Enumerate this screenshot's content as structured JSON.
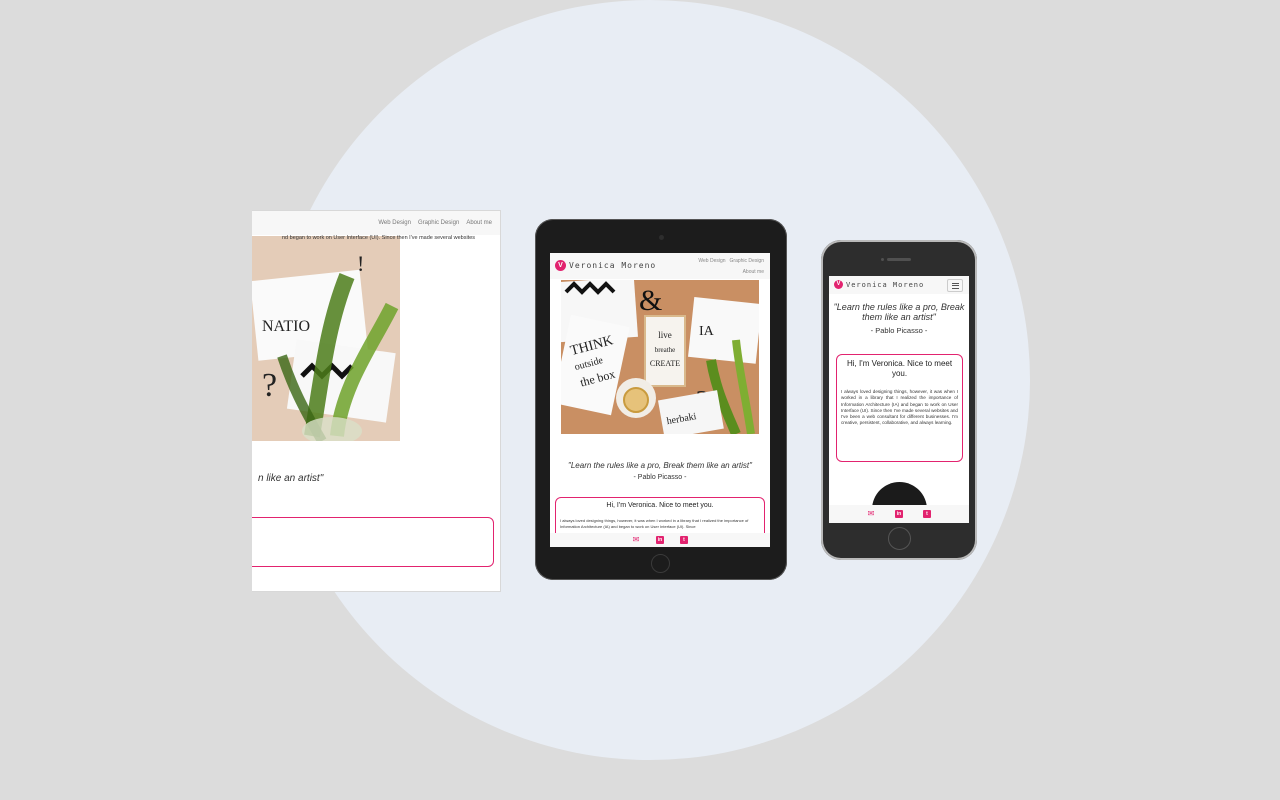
{
  "colors": {
    "accent": "#e2236f",
    "background": "#dcdcdc",
    "circle": "#e8edf4"
  },
  "desktop": {
    "nav": [
      "Web Design",
      "Graphic Design",
      "About me"
    ],
    "quote_partial": "n like an artist\"",
    "card_text_partial": "nd began to work on User Interface (UI). Since then I've made several websites"
  },
  "tablet": {
    "logo_letter": "V",
    "logo_text": "Veronica Moreno",
    "nav": [
      "Web Design",
      "Graphic Design",
      "About me"
    ],
    "quote": "\"Learn the rules like a pro, Break them like an artist\"",
    "author": "- Pablo Picasso -",
    "card_title": "Hi, I'm Veronica. Nice to meet you.",
    "card_body": "I always loved designing things, however, it was when I worked in a library that I realized the importance of Information Architecture (IA) and began to work on User Interface (UI). Since"
  },
  "phone": {
    "logo_letter": "V",
    "logo_text": "Veronica Moreno",
    "quote": "\"Learn the rules like a pro, Break them like an artist\"",
    "author": "- Pablo Picasso -",
    "card_title": "Hi, I'm Veronica. Nice to meet you.",
    "card_body": "I always loved designing things, however, it was when I worked in a library that I realized the importance of Information Architecture (IA) and began to work on User Interface (UI). Since then I've made several websites and I've been a web consultant for different businesses. I'm creative, persistent, collaborative, and always learning."
  },
  "icons": [
    "envelope-icon",
    "linkedin-icon",
    "twitter-icon"
  ]
}
